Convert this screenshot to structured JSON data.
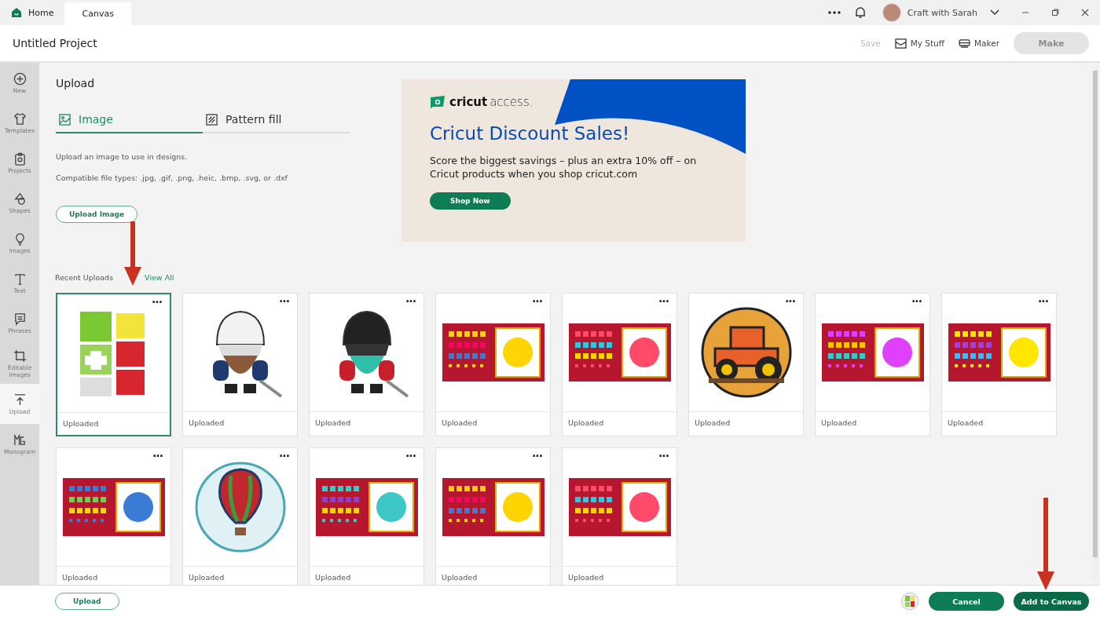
{
  "title_bar": {
    "tabs": [
      {
        "label": "Home",
        "selected": false
      },
      {
        "label": "Canvas",
        "selected": true
      }
    ],
    "account": {
      "name": "Craft with Sarah"
    }
  },
  "header": {
    "project_title": "Untitled Project",
    "actions": [
      {
        "label": "Save",
        "disabled": true
      },
      {
        "label": "My Stuff",
        "disabled": false
      },
      {
        "label": "Maker",
        "disabled": false
      }
    ],
    "make_button": {
      "label": "Make",
      "disabled": true
    }
  },
  "sidebar": {
    "items": [
      {
        "label": "New",
        "selected": false
      },
      {
        "label": "Templates",
        "selected": false
      },
      {
        "label": "Projects",
        "selected": false
      },
      {
        "label": "Shapes",
        "selected": false
      },
      {
        "label": "Images",
        "selected": false
      },
      {
        "label": "Text",
        "selected": false
      },
      {
        "label": "Phrases",
        "selected": false
      },
      {
        "label": "Editable Images",
        "selected": false
      },
      {
        "label": "Upload",
        "selected": true
      },
      {
        "label": "Monogram",
        "selected": false
      }
    ]
  },
  "upload_panel": {
    "title": "Upload",
    "tabs": [
      {
        "label": "Image",
        "selected": true
      },
      {
        "label": "Pattern fill",
        "selected": false
      }
    ],
    "description": "Upload an image to use in designs.",
    "file_types": "Compatible file types: .jpg, .gif, .png, .heic, .bmp, .svg, or .dxf",
    "upload_button": "Upload Image"
  },
  "banner": {
    "brand": "cricut",
    "brand_suffix": "access.",
    "headline": "Cricut Discount Sales!",
    "body": "Score the biggest savings – plus an extra 10% off – on Cricut products when you shop cricut.com",
    "button": "Shop Now"
  },
  "recent_uploads": {
    "label": "Recent Uploads",
    "link": "View All",
    "items": [
      {
        "label": "Uploaded",
        "menu": "···",
        "selected": true
      },
      {
        "label": "Uploaded",
        "menu": "···",
        "selected": false
      },
      {
        "label": "Uploaded",
        "menu": "···",
        "selected": false
      },
      {
        "label": "Uploaded",
        "menu": "···",
        "selected": false
      },
      {
        "label": "Uploaded",
        "menu": "···",
        "selected": false
      },
      {
        "label": "Uploaded",
        "menu": "···",
        "selected": false
      },
      {
        "label": "Uploaded",
        "menu": "···",
        "selected": false
      },
      {
        "label": "Uploaded",
        "menu": "···",
        "selected": false
      },
      {
        "label": "Uploaded",
        "menu": "···",
        "selected": false
      },
      {
        "label": "Uploaded",
        "menu": "···",
        "selected": false
      },
      {
        "label": "Uploaded",
        "menu": "···",
        "selected": false
      },
      {
        "label": "Uploaded",
        "menu": "···",
        "selected": false
      },
      {
        "label": "Uploaded",
        "menu": "···",
        "selected": false
      }
    ]
  },
  "footer": {
    "upload_button": "Upload",
    "cancel_button": "Cancel",
    "add_button": "Add to Canvas"
  }
}
